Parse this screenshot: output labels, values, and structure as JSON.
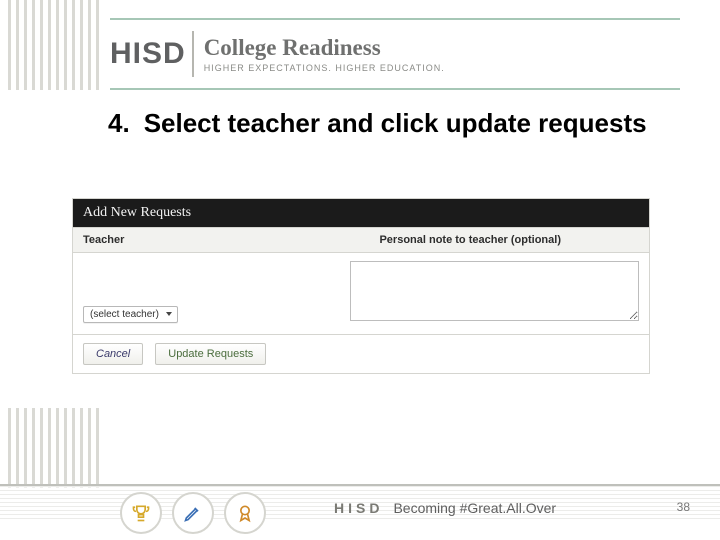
{
  "logo": {
    "brand": "HISD",
    "title": "College Readiness",
    "subtitle": "HIGHER EXPECTATIONS. HIGHER EDUCATION."
  },
  "heading": {
    "number": "4.",
    "text": "Select teacher and click update requests"
  },
  "panel": {
    "title": "Add New Requests",
    "columns": {
      "teacher": "Teacher",
      "note": "Personal note to teacher (optional)"
    },
    "select_placeholder": "(select teacher)",
    "note_value": "",
    "actions": {
      "cancel": "Cancel",
      "update": "Update Requests"
    }
  },
  "footer": {
    "brand": "HISD",
    "tagline": "Becoming #Great.All.Over"
  },
  "page_number": "38",
  "badge_icons": {
    "trophy": "trophy-icon",
    "pencil": "pencil-icon",
    "ribbon": "ribbon-icon"
  }
}
